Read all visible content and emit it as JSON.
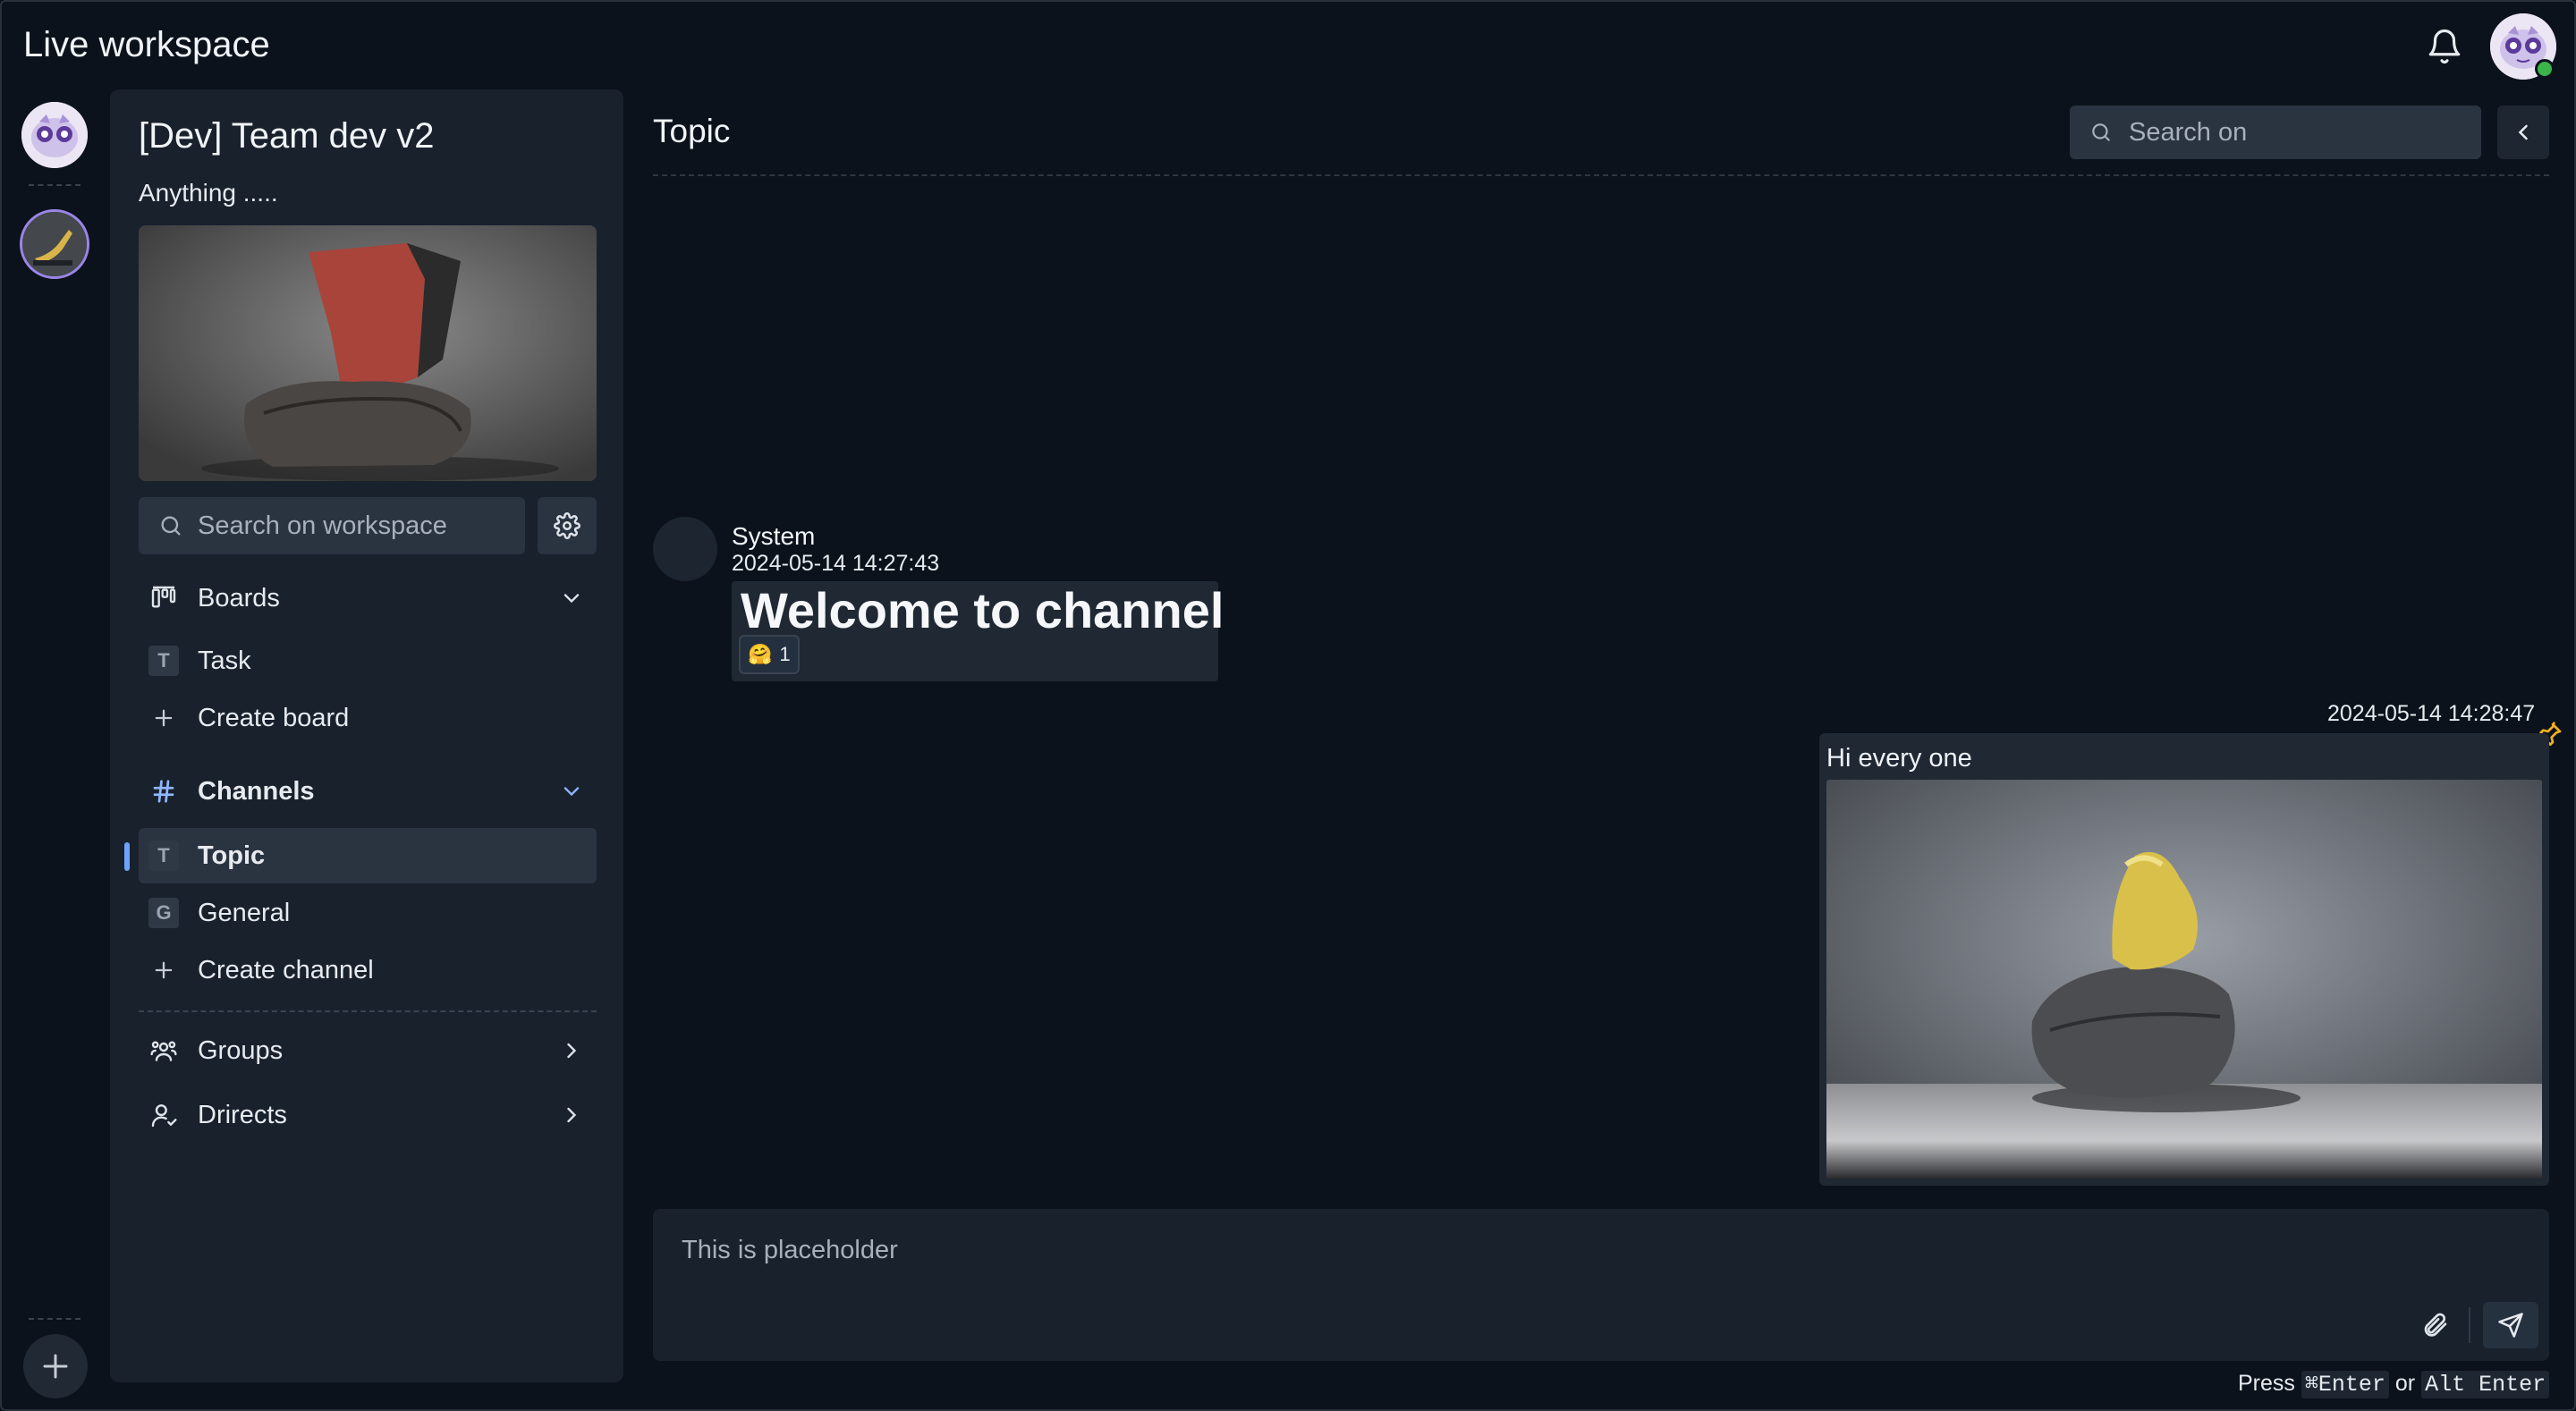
{
  "app": {
    "title": "Live workspace"
  },
  "workspace": {
    "name": "[Dev] Team dev v2",
    "description": "Anything .....",
    "search_placeholder": "Search on workspace"
  },
  "boards": {
    "label": "Boards",
    "items": [
      {
        "badge": "T",
        "label": "Task"
      }
    ],
    "create_label": "Create board"
  },
  "channels": {
    "label": "Channels",
    "items": [
      {
        "badge": "T",
        "label": "Topic",
        "active": true
      },
      {
        "badge": "G",
        "label": "General",
        "active": false
      }
    ],
    "create_label": "Create channel"
  },
  "groups": {
    "label": "Groups"
  },
  "directs": {
    "label": "Drirects"
  },
  "main": {
    "title": "Topic",
    "search_placeholder": "Search on"
  },
  "messages": [
    {
      "author": "System",
      "time": "2024-05-14 14:27:43",
      "text": "Welcome to channel",
      "reaction": {
        "emoji": "🤗",
        "count": "1"
      }
    },
    {
      "time": "2024-05-14 14:28:47",
      "text": "Hi every one",
      "pinned": true
    }
  ],
  "composer": {
    "placeholder": "This is placeholder",
    "hint_prefix": "Press",
    "hint_key1": "⌘Enter",
    "hint_or": "or",
    "hint_key2": "Alt Enter"
  },
  "colors": {
    "background": "#0b121b",
    "sidebar": "#18212c",
    "accent": "#8fb5ff",
    "online": "#39b54a",
    "pin": "#f2b01e"
  }
}
